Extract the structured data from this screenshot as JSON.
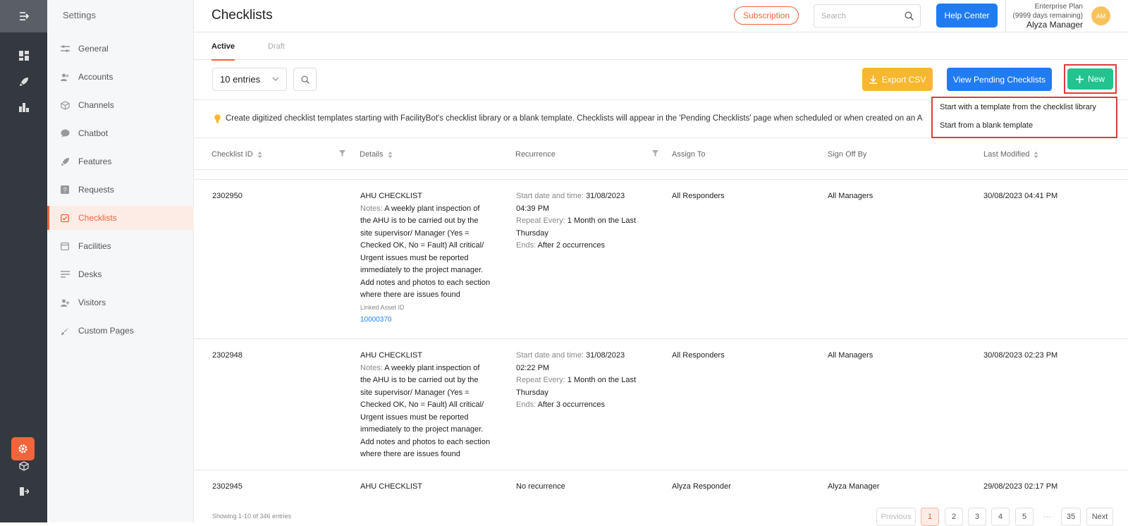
{
  "rail": {
    "icons": [
      "menu-expand-icon",
      "dashboard-icon",
      "rocket-icon",
      "building-icon",
      "settings-gear-icon",
      "cube-icon",
      "logout-icon"
    ]
  },
  "sidebar": {
    "title": "Settings",
    "items": [
      {
        "label": "General",
        "icon": "sliders-icon"
      },
      {
        "label": "Accounts",
        "icon": "users-icon"
      },
      {
        "label": "Channels",
        "icon": "box-icon"
      },
      {
        "label": "Chatbot",
        "icon": "chat-icon"
      },
      {
        "label": "Features",
        "icon": "rocket-icon"
      },
      {
        "label": "Requests",
        "icon": "question-icon"
      },
      {
        "label": "Checklists",
        "icon": "checklist-icon"
      },
      {
        "label": "Facilities",
        "icon": "calendar-icon"
      },
      {
        "label": "Desks",
        "icon": "desk-icon"
      },
      {
        "label": "Visitors",
        "icon": "visitor-icon"
      },
      {
        "label": "Custom Pages",
        "icon": "brush-icon"
      }
    ],
    "active": "Checklists"
  },
  "header": {
    "title": "Checklists",
    "subscription": "Subscription",
    "search_placeholder": "Search",
    "help": "Help Center",
    "plan": "Enterprise Plan",
    "days": "(9999 days remaining)",
    "user": "Alyza Manager",
    "avatar": "AM"
  },
  "tabs": {
    "active": "Active",
    "draft": "Draft"
  },
  "toolbar": {
    "entries": "10 entries",
    "export": "Export CSV",
    "pending": "View Pending Checklists",
    "new": "New"
  },
  "dropdown": {
    "item1": "Start with a template from the checklist library",
    "item2": "Start from a blank template"
  },
  "info": "Create digitized checklist templates starting with FacilityBot's checklist library or a blank template. Checklists will appear in the 'Pending Checklists' page when scheduled or when created on an A",
  "table": {
    "headers": {
      "id": "Checklist ID",
      "details": "Details",
      "recurrence": "Recurrence",
      "assign": "Assign To",
      "signoff": "Sign Off By",
      "modified": "Last Modified"
    },
    "rows": [
      {
        "id": "2302950",
        "title": "AHU CHECKLIST",
        "notes_label": "Notes:",
        "notes_l1": "A weekly plant inspection of",
        "notes_l2": "the AHU is to be carried out by the",
        "notes_l3": "site supervisor/ Manager (Yes =",
        "notes_l4": "Checked OK, No = Fault) All critical/",
        "notes_l5": "Urgent issues must be reported",
        "notes_l6": "immediately to the project manager.",
        "notes_l7": "Add notes and photos to each section",
        "notes_l8": "where there are issues found",
        "asset_label": "Linked Asset ID",
        "asset_id": "10000370",
        "start_label": "Start date and time:",
        "start_date": "31/08/2023",
        "start_time": "04:39 PM",
        "repeat_label": "Repeat Every:",
        "repeat_val": "1 Month on the Last",
        "repeat_val2": "Thursday",
        "ends_label": "Ends:",
        "ends_val": "After 2 occurrences",
        "assign": "All Responders",
        "signoff": "All Managers",
        "modified": "30/08/2023 04:41 PM"
      },
      {
        "id": "2302948",
        "title": "AHU CHECKLIST",
        "notes_label": "Notes:",
        "notes_l1": "A weekly plant inspection of",
        "notes_l2": "the AHU is to be carried out by the",
        "notes_l3": "site supervisor/ Manager (Yes =",
        "notes_l4": "Checked OK, No = Fault) All critical/",
        "notes_l5": "Urgent issues must be reported",
        "notes_l6": "immediately to the project manager.",
        "notes_l7": "Add notes and photos to each section",
        "notes_l8": "where there are issues found",
        "start_label": "Start date and time:",
        "start_date": "31/08/2023",
        "start_time": "02:22 PM",
        "repeat_label": "Repeat Every:",
        "repeat_val": "1 Month on the Last",
        "repeat_val2": "Thursday",
        "ends_label": "Ends:",
        "ends_val": "After 3 occurrences",
        "assign": "All Responders",
        "signoff": "All Managers",
        "modified": "30/08/2023 02:23 PM"
      },
      {
        "id": "2302945",
        "title": "AHU CHECKLIST",
        "recurrence": "No recurrence",
        "assign": "Alyza Responder",
        "signoff": "Alyza Manager",
        "modified": "29/08/2023 02:17 PM"
      }
    ]
  },
  "footer": {
    "showing": "Showing 1-10 of 346 entries",
    "previous": "Previous",
    "pages": [
      "1",
      "2",
      "3",
      "4",
      "5"
    ],
    "ellipsis": "···",
    "last": "35",
    "next": "Next"
  },
  "colors": {
    "accent": "#f2643a",
    "blue": "#1f7cf2",
    "green": "#22c38e",
    "yellow": "#f9b730",
    "rail": "#34393f"
  }
}
